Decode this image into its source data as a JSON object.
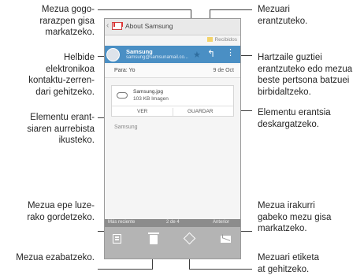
{
  "callouts": {
    "mark_important": [
      "Mezua gogo-",
      "rarazpen gisa",
      "markatzeko."
    ],
    "add_contact": [
      "Helbide",
      "elektronikoa",
      "kontaktu-zerren-",
      "dari gehitzeko."
    ],
    "preview_attachment": [
      "Elementu erant-",
      "siaren aurrebista",
      "ikusteko."
    ],
    "save_for_later": [
      "Mezua epe luze-",
      "rako gordetzeko."
    ],
    "delete_message": "Mezua ezabatzeko.",
    "reply": [
      "Mezuari",
      "erantzuteko."
    ],
    "reply_all_forward": [
      "Hartzaile guztiei",
      "erantzuteko edo mezua",
      "beste pertsona batzuei",
      "birbidaltzeko."
    ],
    "download_attachment": [
      "Elementu erantsia",
      "deskargatzeko."
    ],
    "mark_unread": [
      "Mezua irakurri",
      "gabeko mezu gisa",
      "markatzeko."
    ],
    "add_label": [
      "Mezuari etiketa",
      "at gehitzeko."
    ]
  },
  "phone": {
    "title": "About Samsung",
    "label_tag": "Recibidos",
    "sender_name": "Samsung",
    "sender_email": "samsung@samsunamail.co...",
    "to_label": "Para: Yo",
    "date": "9 de Oct",
    "attachment": {
      "filename": "Samsung.jpg",
      "size": "103 KB Imagen",
      "view_label": "VER",
      "save_label": "GUARDAR"
    },
    "body_text": "Samsung",
    "status": {
      "newer": "Más reciente",
      "position": "2 de 4",
      "older": "Anterior"
    }
  },
  "icons": {
    "back": "chevron-left-icon",
    "app": "gmail-icon",
    "star": "star-icon",
    "reply": "reply-icon",
    "overflow": "more-vertical-icon",
    "archive": "archive-icon",
    "delete": "trash-icon",
    "label": "tag-icon",
    "unread": "mail-icon"
  },
  "colors": {
    "header_blue": "#4a8fc4",
    "toolbar_gray": "#b4b4b4",
    "status_gray": "#8c8c8c"
  }
}
